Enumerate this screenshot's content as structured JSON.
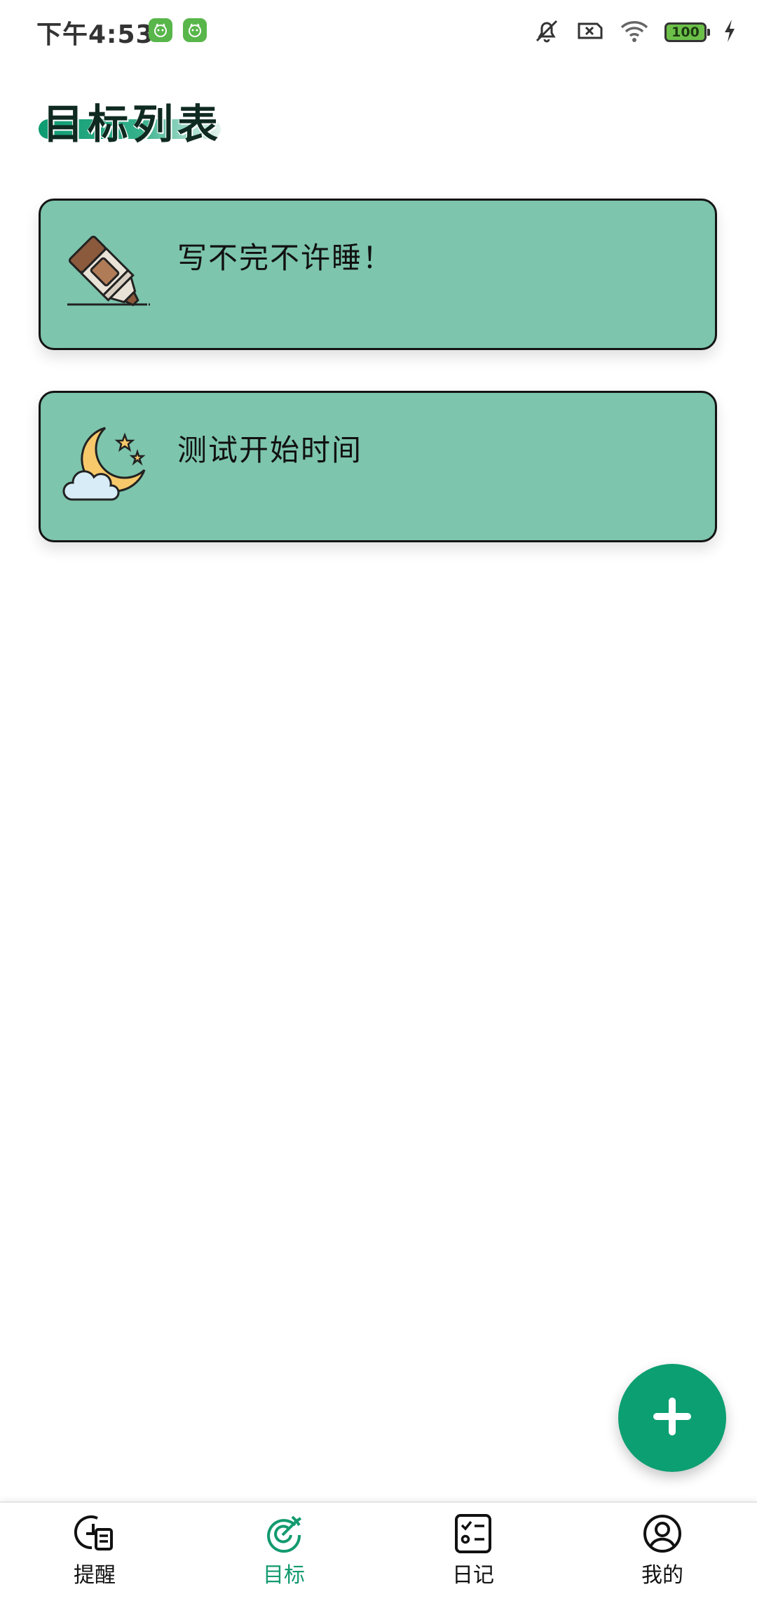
{
  "status_bar": {
    "time": "下午4:53",
    "battery_level": "100",
    "app_icons": [
      "app-notification-icon",
      "app-notification-icon"
    ],
    "indicators": [
      "mute-icon",
      "no-sim-icon",
      "wifi-icon",
      "battery-icon",
      "charging-icon"
    ]
  },
  "header": {
    "title": "目标列表"
  },
  "goals": [
    {
      "title": "写不完不许睡！",
      "icon": "marker-pen-icon"
    },
    {
      "title": "测试开始时间",
      "icon": "moon-cloud-icon"
    }
  ],
  "fab": {
    "icon": "plus-icon"
  },
  "bottom_nav": {
    "items": [
      {
        "label": "提醒",
        "icon": "reminder-icon",
        "active": false
      },
      {
        "label": "目标",
        "icon": "target-icon",
        "active": true
      },
      {
        "label": "日记",
        "icon": "diary-icon",
        "active": false
      },
      {
        "label": "我的",
        "icon": "profile-icon",
        "active": false
      }
    ]
  },
  "colors": {
    "accent": "#0c9f72",
    "card_background": "#7dc5ad",
    "nav_active": "#139a6f"
  }
}
